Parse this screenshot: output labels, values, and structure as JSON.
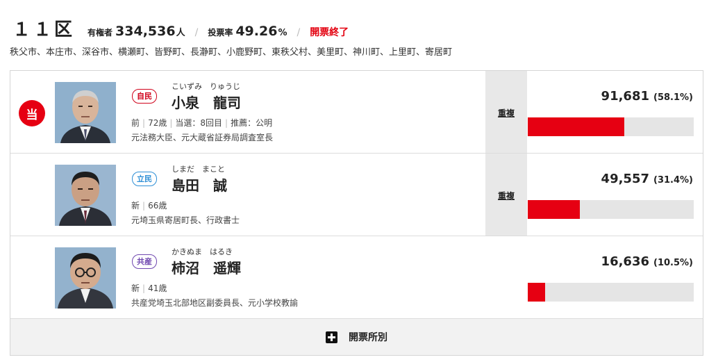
{
  "header": {
    "district": "１１区",
    "electorate_label": "有権者",
    "electorate_value": "334,536",
    "electorate_unit": "人",
    "turnout_label": "投票率",
    "turnout_value": "49.26",
    "turnout_unit": "%",
    "status": "開票終了",
    "separator": "/"
  },
  "areas": "秩父市、本庄市、深谷市、横瀬町、皆野町、長瀞町、小鹿野町、東秩父村、美里町、神川町、上里町、寄居町",
  "colors": {
    "accent": "#e60012",
    "ldp": "#d0021b",
    "cdp": "#2e8fd6",
    "jcp": "#7048b0"
  },
  "candidates": [
    {
      "elected": true,
      "elected_label": "当",
      "party": "自民",
      "party_color": "#d0021b",
      "kana": "こいずみ　りゅうじ",
      "name": "小泉　龍司",
      "status": "前",
      "age": "72歳",
      "wins": "当選：8回目",
      "endorsement": "推薦：公明",
      "career": "元法務大臣、元大蔵省証券局調査室長",
      "duplicate": "重複",
      "votes": "91,681",
      "percent": "(58.1%)",
      "share": 58.1
    },
    {
      "elected": false,
      "elected_label": "",
      "party": "立民",
      "party_color": "#2e8fd6",
      "kana": "しまだ　まこと",
      "name": "島田　誠",
      "status": "新",
      "age": "66歳",
      "wins": "",
      "endorsement": "",
      "career": "元埼玉県寄居町長、行政書士",
      "duplicate": "重複",
      "votes": "49,557",
      "percent": "(31.4%)",
      "share": 31.4
    },
    {
      "elected": false,
      "elected_label": "",
      "party": "共産",
      "party_color": "#7048b0",
      "kana": "かきぬま　はるき",
      "name": "柿沼　遥輝",
      "status": "新",
      "age": "41歳",
      "wins": "",
      "endorsement": "",
      "career": "共産党埼玉北部地区副委員長、元小学校教諭",
      "duplicate": "",
      "votes": "16,636",
      "percent": "(10.5%)",
      "share": 10.5
    }
  ],
  "footer": {
    "label": "開票所別",
    "icon": "plus-icon"
  }
}
